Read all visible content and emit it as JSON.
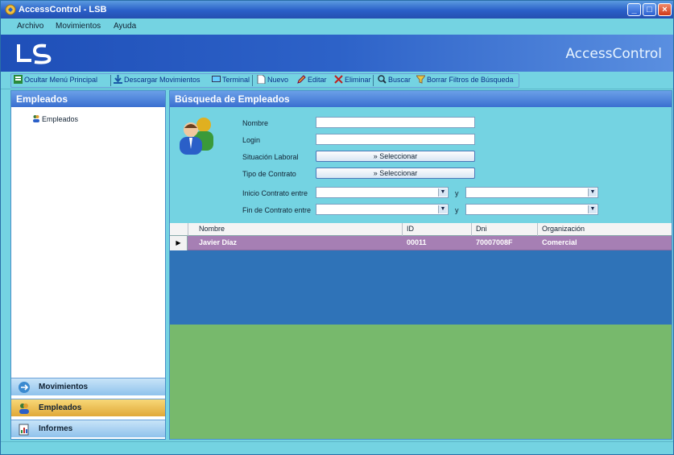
{
  "window": {
    "title": "AccessControl - LSB"
  },
  "menu": {
    "items": [
      "Archivo",
      "Movimientos",
      "Ayuda"
    ]
  },
  "banner": {
    "brand": "AccessControl"
  },
  "toolbar": {
    "items": [
      {
        "label": "Ocultar Menú Principal",
        "icon": "menu-icon"
      },
      {
        "label": "Descargar Movimientos",
        "icon": "download-icon"
      },
      {
        "label": "Terminal",
        "icon": "terminal-icon"
      },
      {
        "label": "Nuevo",
        "icon": "new-icon"
      },
      {
        "label": "Editar",
        "icon": "edit-icon"
      },
      {
        "label": "Eliminar",
        "icon": "delete-icon"
      },
      {
        "label": "Buscar",
        "icon": "search-icon"
      },
      {
        "label": "Borrar Filtros de Búsqueda",
        "icon": "clear-filter-icon"
      }
    ]
  },
  "sidebar": {
    "header": "Empleados",
    "tree": [
      {
        "label": "Empleados"
      }
    ],
    "nav": [
      {
        "label": "Movimientos",
        "active": false
      },
      {
        "label": "Empleados",
        "active": true
      },
      {
        "label": "Informes",
        "active": false
      }
    ]
  },
  "search": {
    "header": "Búsqueda de Empleados",
    "labels": {
      "nombre": "Nombre",
      "login": "Login",
      "situacion": "Situación Laboral",
      "tipo": "Tipo de Contrato",
      "inicio": "Inicio Contrato entre",
      "fin": "Fin de Contrato entre",
      "y": "y"
    },
    "values": {
      "nombre": "",
      "login": ""
    },
    "select_label": "Seleccionar"
  },
  "grid": {
    "columns": [
      "Nombre",
      "ID",
      "Dni",
      "Organización"
    ],
    "rows": [
      {
        "nombre": "Javier Díaz",
        "id": "00011",
        "dni": "70007008F",
        "org": "Comercial"
      }
    ]
  },
  "colors": {
    "grid_row": "#a67fb4",
    "grid_blue": "#2f73b8",
    "grid_green": "#77b96c",
    "window_bg": "#74d3e2"
  }
}
